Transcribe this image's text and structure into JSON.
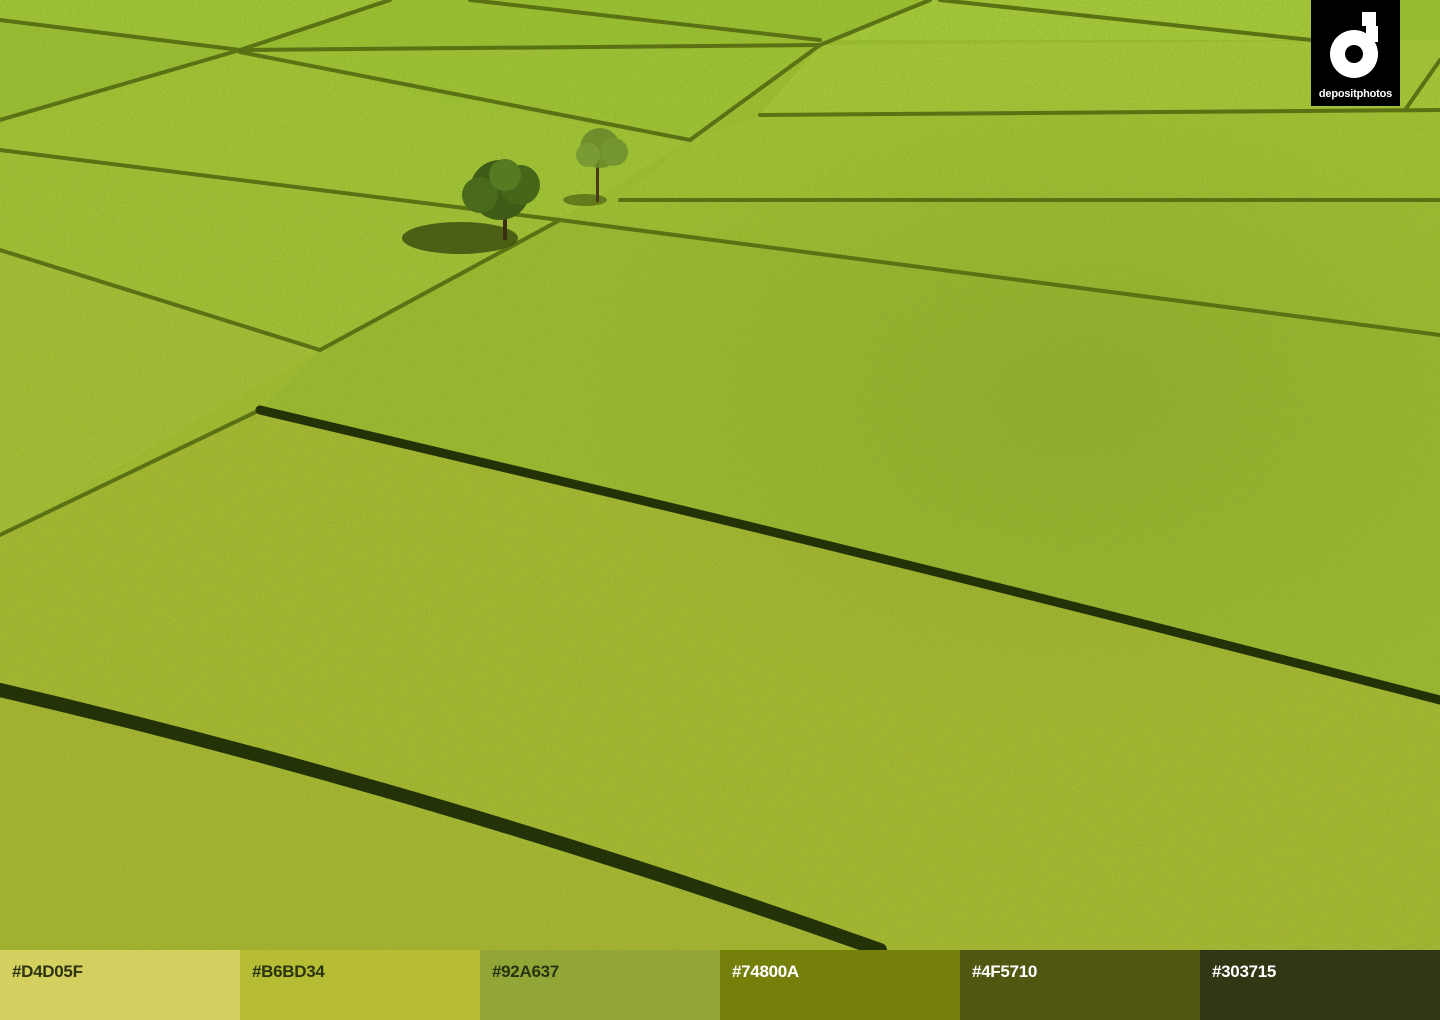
{
  "watermark": {
    "brand": "depositphotos",
    "icon": "depositphotos-logo-icon"
  },
  "palette": [
    {
      "hex_label": "#D4D05F",
      "color": "#D4D05F",
      "text_color": "#2e3410"
    },
    {
      "hex_label": "#B6BD34",
      "color": "#B6BD34",
      "text_color": "#2b3410"
    },
    {
      "hex_label": "#92A637",
      "color": "#92A637",
      "text_color": "#263410"
    },
    {
      "hex_label": "#74800A",
      "color": "#74800A",
      "text_color": "#ffffff"
    },
    {
      "hex_label": "#4F5710",
      "color": "#4F5710",
      "text_color": "#ffffff"
    },
    {
      "hex_label": "#303715",
      "color": "#303715",
      "text_color": "#ffffff"
    }
  ]
}
